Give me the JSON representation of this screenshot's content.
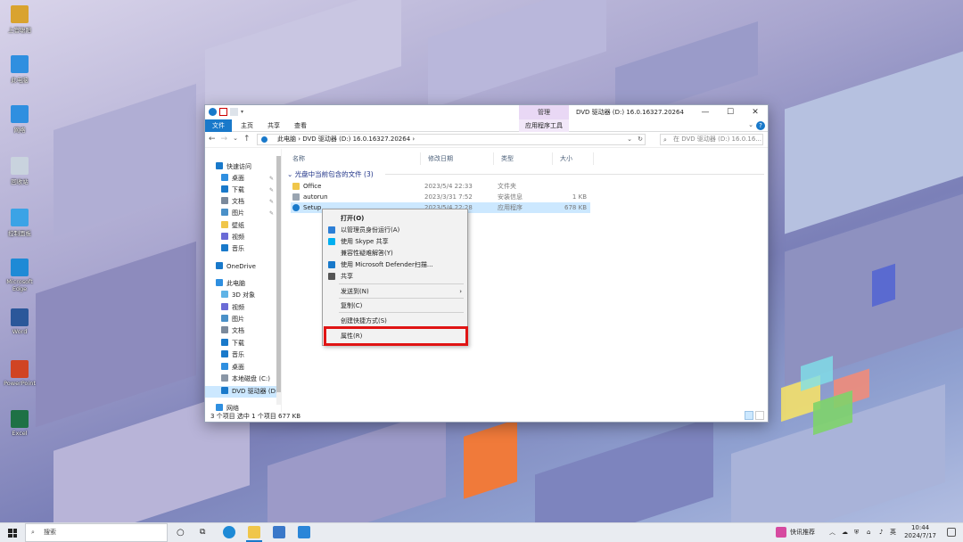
{
  "desktop": {
    "icons": [
      {
        "label": "上官聪阳",
        "icon": "user-folder-icon",
        "color": "#d9a32f"
      },
      {
        "label": "此电脑",
        "icon": "this-pc-icon",
        "color": "#2f8fe0"
      },
      {
        "label": "网络",
        "icon": "network-icon",
        "color": "#2f8fe0"
      },
      {
        "label": "回收站",
        "icon": "recycle-bin-icon",
        "color": "#c9d3de"
      },
      {
        "label": "控制面板",
        "icon": "control-panel-icon",
        "color": "#3ba3e6"
      },
      {
        "label": "Microsoft Edge",
        "icon": "edge-icon",
        "color": "#1e8ad6"
      },
      {
        "label": "Word",
        "icon": "word-icon",
        "color": "#2b579a"
      },
      {
        "label": "PowerPoint",
        "icon": "powerpoint-icon",
        "color": "#d04423"
      },
      {
        "label": "Excel",
        "icon": "excel-icon",
        "color": "#1e7145"
      }
    ]
  },
  "window": {
    "title": "DVD 驱动器 (D:) 16.0.16327.20264",
    "context_tab": "管理",
    "tabs": [
      "文件",
      "主页",
      "共享",
      "查看",
      "应用程序工具"
    ],
    "address": "此电脑  ›  DVD 驱动器 (D:) 16.0.16327.20264  ›",
    "search_placeholder": "在 DVD 驱动器 (D:) 16.0.16...",
    "nav": [
      {
        "label": "快速访问",
        "icon": "star-icon",
        "color": "#1979ca"
      },
      {
        "label": "桌面",
        "icon": "desktop-icon",
        "color": "#2f8fe0",
        "pinned": true
      },
      {
        "label": "下载",
        "icon": "download-icon",
        "color": "#1979ca",
        "pinned": true
      },
      {
        "label": "文档",
        "icon": "documents-icon",
        "color": "#7b8a9c",
        "pinned": true
      },
      {
        "label": "图片",
        "icon": "pictures-icon",
        "color": "#4a90c8",
        "pinned": true
      },
      {
        "label": "壁纸",
        "icon": "folder-icon",
        "color": "#f0c64a"
      },
      {
        "label": "视频",
        "icon": "videos-icon",
        "color": "#6b6bd6"
      },
      {
        "label": "音乐",
        "icon": "music-icon",
        "color": "#1979ca"
      },
      {
        "label": "OneDrive",
        "icon": "onedrive-icon",
        "color": "#1979ca"
      },
      {
        "label": "此电脑",
        "icon": "this-pc-icon",
        "color": "#2f8fe0"
      },
      {
        "label": "3D 对象",
        "icon": "3d-objects-icon",
        "color": "#5fb3e6"
      },
      {
        "label": "视频",
        "icon": "videos-icon",
        "color": "#6b6bd6"
      },
      {
        "label": "图片",
        "icon": "pictures-icon",
        "color": "#4a90c8"
      },
      {
        "label": "文档",
        "icon": "documents-icon",
        "color": "#7b8a9c"
      },
      {
        "label": "下载",
        "icon": "download-icon",
        "color": "#1979ca"
      },
      {
        "label": "音乐",
        "icon": "music-icon",
        "color": "#1979ca"
      },
      {
        "label": "桌面",
        "icon": "desktop-icon",
        "color": "#2f8fe0"
      },
      {
        "label": "本地磁盘 (C:)",
        "icon": "drive-icon",
        "color": "#8a96a6"
      },
      {
        "label": "DVD 驱动器 (D:",
        "icon": "dvd-drive-icon",
        "color": "#1979ca",
        "selected": true
      },
      {
        "label": "网络",
        "icon": "network-icon",
        "color": "#2f8fe0"
      }
    ],
    "columns": [
      "名称",
      "修改日期",
      "类型",
      "大小"
    ],
    "group_label": "光盘中当前包含的文件 (3)",
    "files": [
      {
        "name": "Office",
        "date": "2023/5/4 22:33",
        "type": "文件夹",
        "size": "",
        "icon": "folder-icon",
        "color": "#f0c64a"
      },
      {
        "name": "autorun",
        "date": "2023/3/31 7:52",
        "type": "安装信息",
        "size": "1 KB",
        "icon": "setup-info-icon",
        "color": "#9aa5b1"
      },
      {
        "name": "Setup",
        "date": "2023/5/4 22:28",
        "type": "应用程序",
        "size": "678 KB",
        "icon": "setup-app-icon",
        "color": "#1979ca",
        "selected": true
      }
    ],
    "status": "3 个项目    选中 1 个项目  677 KB"
  },
  "context_menu": {
    "items": [
      {
        "label": "打开(O)",
        "bold": true
      },
      {
        "label": "以管理员身份运行(A)",
        "icon": "shield-icon",
        "color": "#2d7fd6"
      },
      {
        "label": "使用 Skype 共享",
        "icon": "skype-icon",
        "color": "#00aff0"
      },
      {
        "label": "兼容性疑难解答(Y)"
      },
      {
        "label": "使用 Microsoft Defender扫描...",
        "icon": "defender-icon",
        "color": "#1979ca"
      },
      {
        "label": "共享",
        "icon": "share-icon",
        "color": "#555555"
      },
      {
        "label": "发送到(N)",
        "submenu": true
      },
      {
        "label": "复制(C)"
      },
      {
        "label": "创建快捷方式(S)"
      },
      {
        "label": "属性(R)",
        "highlighted": true
      }
    ],
    "submenu_arrow": "›"
  },
  "taskbar": {
    "search_placeholder": "搜索",
    "news_label": "快讯推荐",
    "ime": "英",
    "time": "10:44",
    "date": "2024/7/17"
  }
}
